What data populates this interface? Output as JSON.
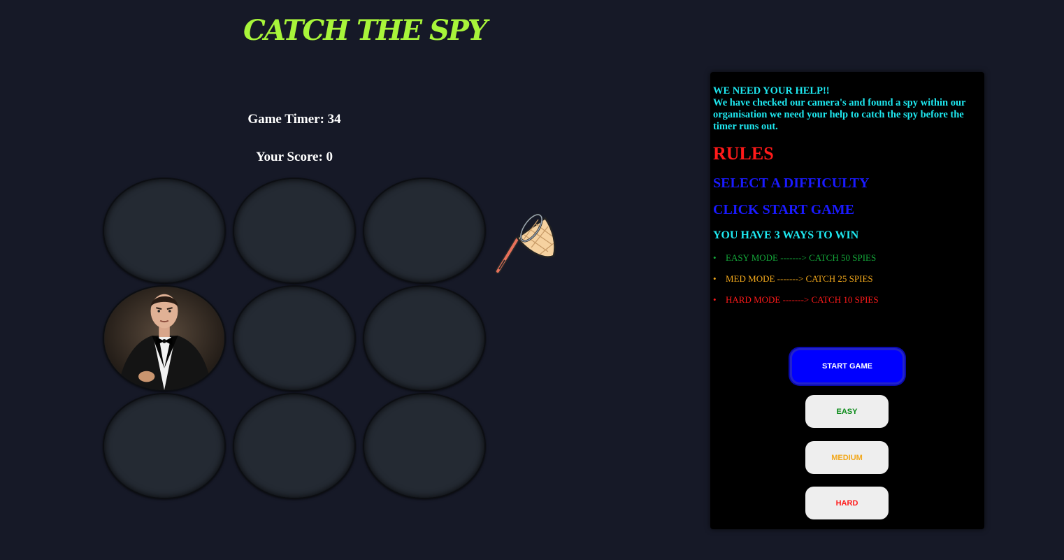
{
  "title": "CATCH THE SPY",
  "stats": {
    "timer_label": "Game Timer: 34",
    "score_label": "Your Score: 0"
  },
  "board": {
    "holes": 9,
    "active_hole": 4,
    "spy_icon": "spy-portrait"
  },
  "cursor_icon": "butterfly-net-icon",
  "panel": {
    "help_heading": "WE NEED YOUR HELP!!",
    "help_text": "We have checked our camera's and found a spy within our organisation we need your help to catch the spy before the timer runs out.",
    "rules_heading": "RULES",
    "step1": "SELECT A DIFFICULTY",
    "step2": "CLICK START GAME",
    "ways_heading": "YOU HAVE 3 WAYS TO WIN",
    "modes": [
      {
        "label": "EASY MODE -------> CATCH 50 SPIES"
      },
      {
        "label": "MED MODE -------> CATCH 25 SPIES"
      },
      {
        "label": "HARD MODE -------> CATCH 10 SPIES"
      }
    ]
  },
  "buttons": {
    "start": "START GAME",
    "easy": "EASY",
    "medium": "MEDIUM",
    "hard": "HARD"
  },
  "colors": {
    "background": "#161927",
    "title": "#a8f53a",
    "help": "#1ee8f0",
    "rules": "#ff1a1a",
    "steps": "#1a1aff",
    "easy": "#14a83a",
    "medium": "#f2a81c",
    "hard": "#ff1a1a",
    "start_button": "#0000ff"
  }
}
